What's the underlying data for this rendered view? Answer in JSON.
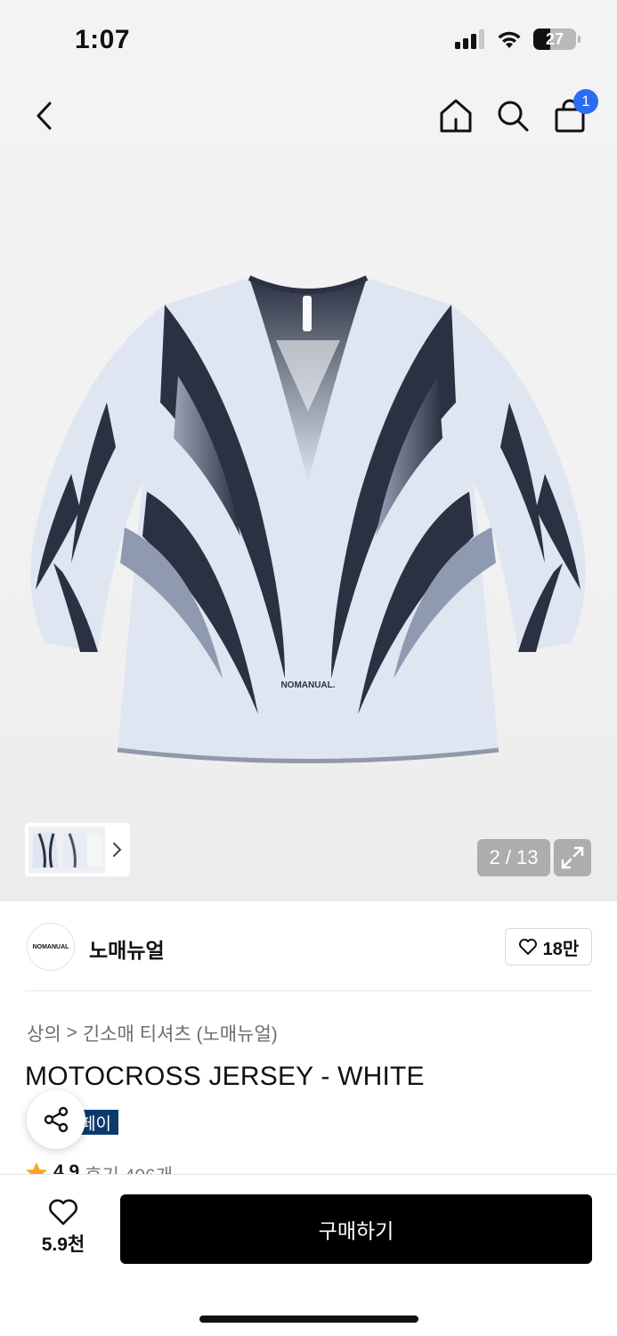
{
  "status_bar": {
    "time": "1:07",
    "battery": "27"
  },
  "header": {
    "cart_count": "1"
  },
  "gallery": {
    "counter": "2 / 13"
  },
  "brand": {
    "logo_text": "NOMANUAL",
    "name": "노매뉴얼",
    "likes": "18만"
  },
  "breadcrumb": {
    "category": "상의",
    "separator": ">",
    "subcategory": "긴소매 티셔츠 (노매뉴얼)"
  },
  "product": {
    "title": "MOTOCROSS JERSEY - WHITE",
    "pay_badge": "페이",
    "rating": "4.9",
    "reviews": "후기 406개",
    "print_text": "NOMANUAL."
  },
  "bottom_bar": {
    "wish_count": "5.9천",
    "buy_label": "구매하기"
  },
  "colors": {
    "accent": "#2a6df4",
    "badge": "#0b3a6e",
    "jersey": "#dfe6f2",
    "stripe": "#2b3142"
  }
}
